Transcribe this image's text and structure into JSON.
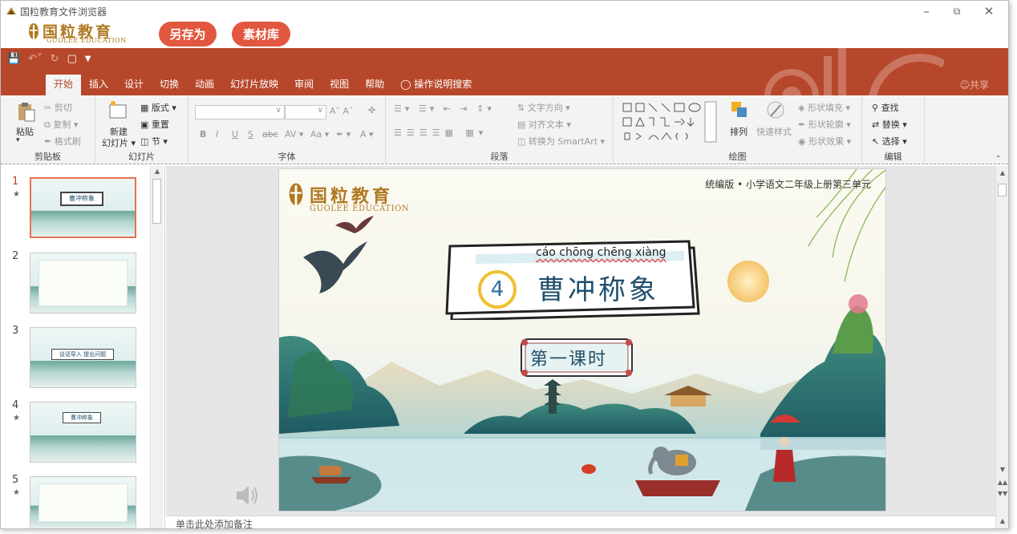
{
  "window": {
    "title": "国粒教育文件浏览器",
    "brand_cn": "国粒教育",
    "brand_en": "GUOLEE EDUCATION",
    "save_as": "另存为",
    "material_library": "素材库"
  },
  "ribbon": {
    "tabs": [
      "开始",
      "插入",
      "设计",
      "切换",
      "动画",
      "幻灯片放映",
      "审阅",
      "视图",
      "帮助",
      "操作说明搜索"
    ],
    "active_tab": "开始",
    "share": "共享",
    "clipboard": {
      "label": "剪贴板",
      "paste": "粘贴",
      "cut": "剪切",
      "copy": "复制",
      "format_painter": "格式刷"
    },
    "slides": {
      "label": "幻灯片",
      "new_slide": "新建",
      "new_slide_2": "幻灯片",
      "layout": "版式",
      "reset": "重置",
      "section": "节"
    },
    "font": {
      "label": "字体",
      "bold": "B",
      "italic": "I",
      "underline": "U",
      "strike": "S",
      "spacing": "abc",
      "case": "Aa"
    },
    "paragraph": {
      "label": "段落",
      "text_direction": "文字方向",
      "align_text": "对齐文本",
      "smartart": "转换为 SmartArt"
    },
    "drawing": {
      "label": "绘图",
      "arrange": "排列",
      "quick_styles": "快速样式",
      "shape_fill": "形状填充",
      "shape_outline": "形状轮廓",
      "shape_effects": "形状效果"
    },
    "editing": {
      "label": "编辑",
      "find": "查找",
      "replace": "替换",
      "select": "选择"
    }
  },
  "thumbnails": [
    {
      "num": "1",
      "star": true,
      "selected": true,
      "text": "曹冲称象"
    },
    {
      "num": "2",
      "star": false,
      "selected": false,
      "text": ""
    },
    {
      "num": "3",
      "star": false,
      "selected": false,
      "text": "谈话导入  提出问题"
    },
    {
      "num": "4",
      "star": true,
      "selected": false,
      "text": "曹冲称象"
    },
    {
      "num": "5",
      "star": true,
      "selected": false,
      "text": ""
    }
  ],
  "slide": {
    "logo_cn": "国粒教育",
    "logo_en": "GUOLEE EDUCATION",
    "subtitle": "统编版 • 小学语文二年级上册第三单元",
    "pinyin": "cáo chōng chēng xiàng",
    "lesson_number": "4",
    "lesson_title": "曹冲称象",
    "period": "第一课时"
  },
  "notes_placeholder": "单击此处添加备注",
  "colors": {
    "ribbon": "#b7472a",
    "pill": "#e2573f",
    "brand_gold": "#b07a22",
    "title_blue": "#1f4f6d"
  }
}
